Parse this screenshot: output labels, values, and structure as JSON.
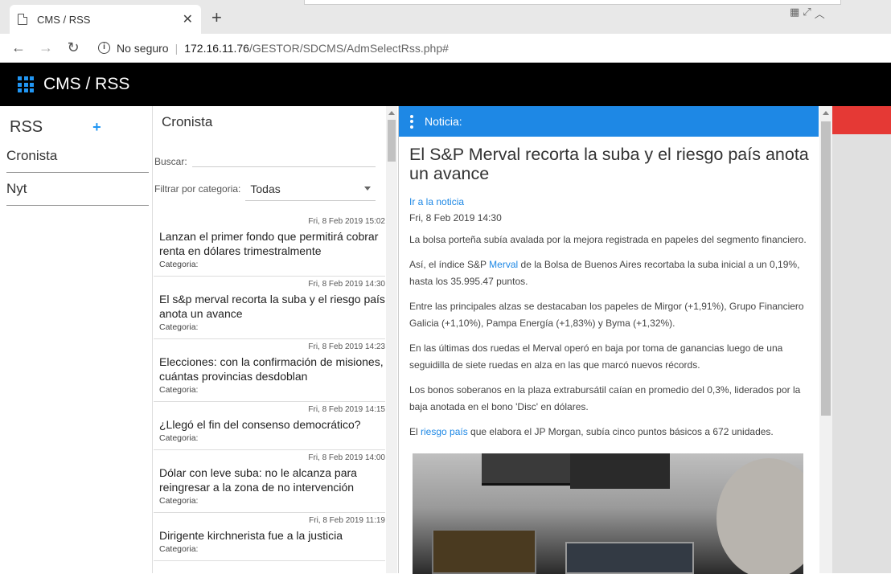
{
  "browser": {
    "tab_title": "CMS / RSS",
    "tab_close": "✕",
    "new_tab": "+",
    "back": "←",
    "forward": "→",
    "reload": "↻",
    "info": "i",
    "security": "No seguro",
    "url_host": "172.16.11.76",
    "url_path": "/GESTOR/SDCMS/AdmSelectRss.php#"
  },
  "app": {
    "title": "CMS / RSS"
  },
  "left": {
    "title": "RSS",
    "add": "+",
    "feeds": [
      "Cronista",
      "Nyt"
    ]
  },
  "mid": {
    "title": "Cronista",
    "search_label": "Buscar:",
    "filter_label": "Filtrar por categoria:",
    "filter_value": "Todas",
    "news": [
      {
        "date": "Fri, 8 Feb 2019 15:02",
        "title": "Lanzan el primer fondo que permitirá cobrar renta en dólares trimestralmente",
        "category": "Categoria:"
      },
      {
        "date": "Fri, 8 Feb 2019 14:30",
        "title": "El s&p merval recorta la suba y el riesgo país anota un avance",
        "category": "Categoria:"
      },
      {
        "date": "Fri, 8 Feb 2019 14:23",
        "title": "Elecciones: con la confirmación de misiones, cuántas provincias desdoblan",
        "category": "Categoria:"
      },
      {
        "date": "Fri, 8 Feb 2019 14:15",
        "title": "¿Llegó el fin del consenso democrático?",
        "category": "Categoria:"
      },
      {
        "date": "Fri, 8 Feb 2019 14:00",
        "title": "Dólar con leve suba: no le alcanza para reingresar a la zona de no intervención",
        "category": "Categoria:"
      },
      {
        "date": "Fri, 8 Feb 2019 11:19",
        "title": "Dirigente kirchnerista fue a la justicia",
        "category": "Categoria:"
      }
    ]
  },
  "article": {
    "header": "Noticia:",
    "title": "El S&P Merval recorta la suba y el riesgo país anota un avance",
    "link": "Ir a la noticia",
    "date": "Fri, 8 Feb 2019 14:30",
    "p1": "La bolsa porteña subía avalada por la mejora registrada en papeles del segmento financiero.",
    "p2_a": "Así, el índice S&P ",
    "p2_link": "Merval",
    "p2_b": " de la Bolsa de Buenos Aires recortaba la suba inicial a un 0,19%, hasta los 35.995.47 puntos.",
    "p3": "Entre las principales alzas se destacaban los papeles de Mirgor (+1,91%), Grupo Financiero Galicia (+1,10%), Pampa Energía (+1,83%) y Byma (+1,32%).",
    "p4": "En las últimas dos ruedas el Merval operó en baja por toma de ganancias luego de una seguidilla de siete ruedas en alza en las que marcó nuevos récords.",
    "p5": "Los bonos soberanos en la plaza extrabursátil caían en promedio del 0,3%, liderados por la baja anotada en el bono 'Disc' en dólares.",
    "p6_a": "El ",
    "p6_link": "riesgo país",
    "p6_b": " que elabora el JP Morgan, subía cinco puntos básicos a 672 unidades."
  },
  "colors": {
    "accent": "#1e88e5",
    "appbar": "#000000",
    "red": "#e53935"
  }
}
